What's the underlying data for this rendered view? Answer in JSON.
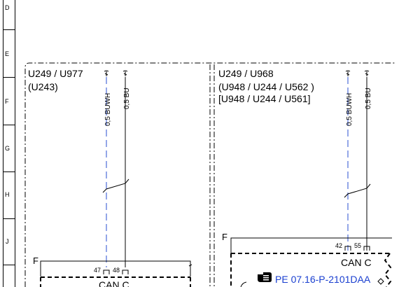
{
  "grid": {
    "rows": [
      "D",
      "E",
      "F",
      "G",
      "H",
      "J"
    ]
  },
  "left_panel": {
    "unit_line1": "U249 / U977",
    "unit_line2": "(U243)",
    "wires": [
      {
        "label": "0,5 BUWH",
        "color": "blue-white"
      },
      {
        "label": "0,5 BU",
        "color": "blue"
      }
    ],
    "connector_letter": "F",
    "pins": [
      "47",
      "48"
    ],
    "module_label": "CAN C"
  },
  "right_panel": {
    "unit_line1": "U249 /  U968",
    "unit_line2": "(U948 / U244 / U562 )",
    "unit_line3": "[U948 / U244 / U561]",
    "wires": [
      {
        "label": "0,5 BUWH",
        "color": "blue-white"
      },
      {
        "label": "0,5 BU",
        "color": "blue"
      }
    ],
    "connector_letter": "F",
    "pins": [
      "42",
      "55"
    ],
    "module_label": "CAN C",
    "reference": "PE 07.16-P-2101DAA",
    "reference_icon": "pointing-hand-icon"
  },
  "colors": {
    "line": "#000000",
    "buwh_wire": "#2a4fd0",
    "reference_link": "#1a3fd0"
  }
}
